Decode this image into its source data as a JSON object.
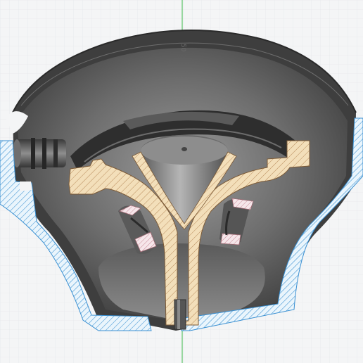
{
  "viewport": {
    "dimension_label": "50"
  },
  "colors": {
    "background": "#f4f5f6",
    "grid_line": "#dde1e5",
    "y_axis": "#3cb94a",
    "x_axis": "#d55a5a",
    "housing_dark": "#4f4f4f",
    "housing_mid": "#8a8a8a",
    "section_cream": "#f1ddb8",
    "section_hatch": "#b88a5a",
    "section_blue": "#e9f4fb",
    "section_blue_hatch": "#3c8fd0"
  }
}
